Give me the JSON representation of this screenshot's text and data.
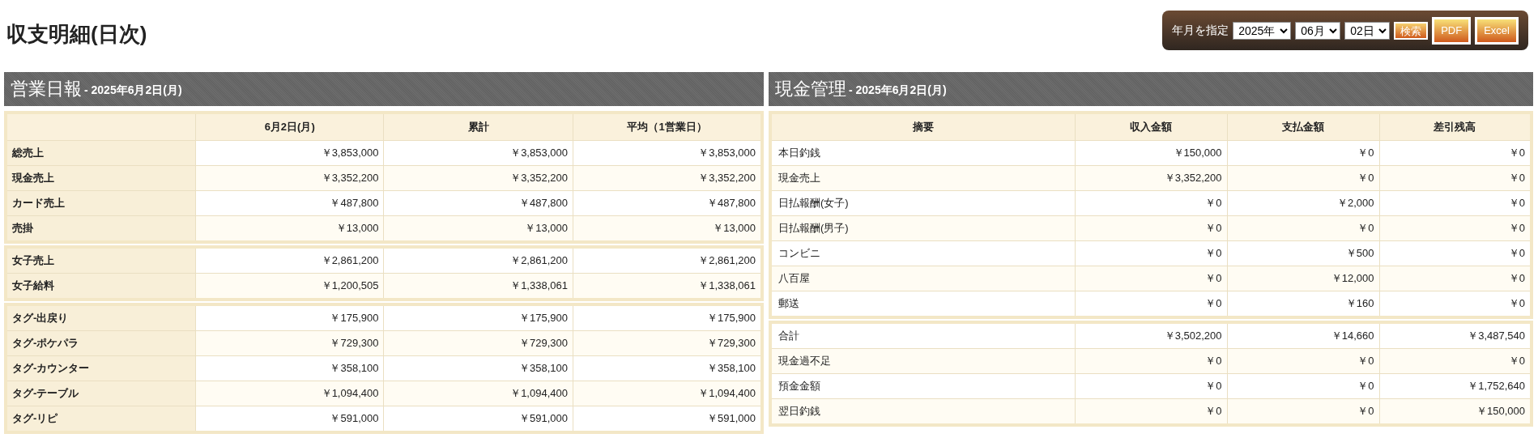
{
  "page_title": "収支明細(日次)",
  "toolbar": {
    "label": "年月を指定",
    "year": "2025年",
    "month": "06月",
    "day": "02日",
    "search_button": "検索",
    "export_buttons": [
      "PDF",
      "Excel"
    ]
  },
  "daily_report": {
    "title": "営業日報",
    "subtitle": "- 2025年6月2日(月)",
    "columns": [
      "6月2日(月)",
      "累計",
      "平均（1営業日）"
    ],
    "groups": [
      [
        {
          "label": "総売上",
          "values": [
            "￥3,853,000",
            "￥3,853,000",
            "￥3,853,000"
          ]
        },
        {
          "label": "現金売上",
          "values": [
            "￥3,352,200",
            "￥3,352,200",
            "￥3,352,200"
          ]
        },
        {
          "label": "カード売上",
          "values": [
            "￥487,800",
            "￥487,800",
            "￥487,800"
          ]
        },
        {
          "label": "売掛",
          "values": [
            "￥13,000",
            "￥13,000",
            "￥13,000"
          ]
        }
      ],
      [
        {
          "label": "女子売上",
          "values": [
            "￥2,861,200",
            "￥2,861,200",
            "￥2,861,200"
          ]
        },
        {
          "label": "女子給料",
          "values": [
            "￥1,200,505",
            "￥1,338,061",
            "￥1,338,061"
          ]
        }
      ],
      [
        {
          "label": "タグ-出戻り",
          "values": [
            "￥175,900",
            "￥175,900",
            "￥175,900"
          ]
        },
        {
          "label": "タグ-ポケパラ",
          "values": [
            "￥729,300",
            "￥729,300",
            "￥729,300"
          ]
        },
        {
          "label": "タグ-カウンター",
          "values": [
            "￥358,100",
            "￥358,100",
            "￥358,100"
          ]
        },
        {
          "label": "タグ-テーブル",
          "values": [
            "￥1,094,400",
            "￥1,094,400",
            "￥1,094,400"
          ]
        },
        {
          "label": "タグ-リピ",
          "values": [
            "￥591,000",
            "￥591,000",
            "￥591,000"
          ]
        }
      ]
    ]
  },
  "cash_management": {
    "title": "現金管理",
    "subtitle": "- 2025年6月2日(月)",
    "columns": [
      "摘要",
      "収入金額",
      "支払金額",
      "差引残高"
    ],
    "groups": [
      [
        {
          "label": "本日釣銭",
          "values": [
            "￥150,000",
            "￥0",
            "￥0"
          ]
        },
        {
          "label": "現金売上",
          "values": [
            "￥3,352,200",
            "￥0",
            "￥0"
          ]
        },
        {
          "label": "日払報酬(女子)",
          "values": [
            "￥0",
            "￥2,000",
            "￥0"
          ]
        },
        {
          "label": "日払報酬(男子)",
          "values": [
            "￥0",
            "￥0",
            "￥0"
          ]
        },
        {
          "label": "コンビニ",
          "values": [
            "￥0",
            "￥500",
            "￥0"
          ]
        },
        {
          "label": "八百屋",
          "values": [
            "￥0",
            "￥12,000",
            "￥0"
          ]
        },
        {
          "label": "郵送",
          "values": [
            "￥0",
            "￥160",
            "￥0"
          ]
        }
      ],
      [
        {
          "label": "合計",
          "values": [
            "￥3,502,200",
            "￥14,660",
            "￥3,487,540"
          ]
        },
        {
          "label": "現金過不足",
          "values": [
            "￥0",
            "￥0",
            "￥0"
          ]
        },
        {
          "label": "預金金額",
          "values": [
            "￥0",
            "￥0",
            "￥1,752,640"
          ]
        },
        {
          "label": "翌日釣銭",
          "values": [
            "￥0",
            "￥0",
            "￥150,000"
          ]
        }
      ]
    ]
  }
}
